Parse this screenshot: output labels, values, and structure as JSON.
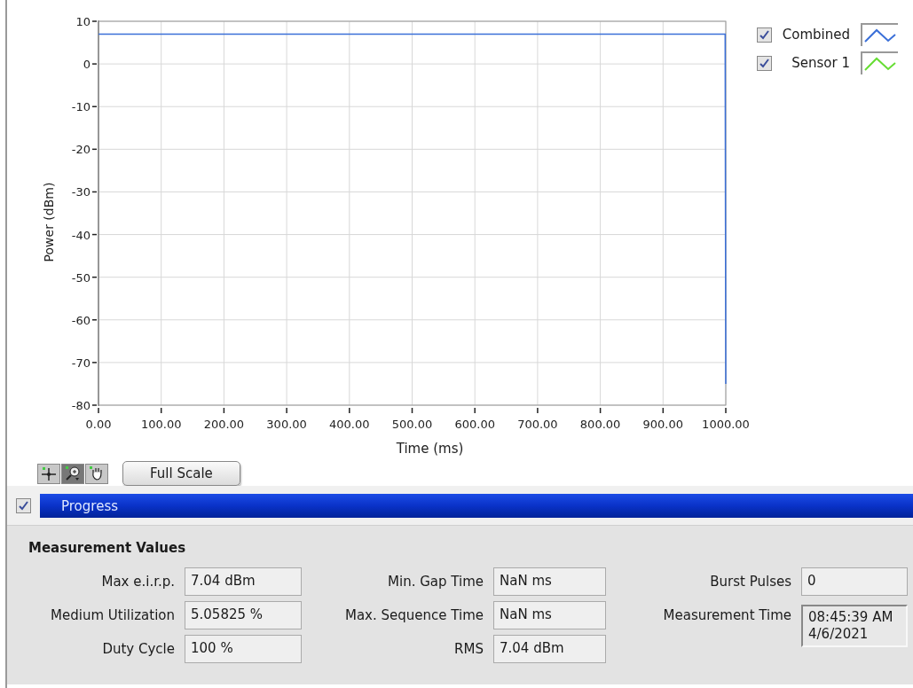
{
  "graph": {
    "chart_data": {
      "type": "line",
      "xlabel": "Time (ms)",
      "ylabel": "Power (dBm)",
      "xlim": [
        0,
        1000
      ],
      "ylim": [
        -80,
        10
      ],
      "grid": true,
      "xticks": [
        {
          "value": 0,
          "label": "0.00"
        },
        {
          "value": 100,
          "label": "100.00"
        },
        {
          "value": 200,
          "label": "200.00"
        },
        {
          "value": 300,
          "label": "300.00"
        },
        {
          "value": 400,
          "label": "400.00"
        },
        {
          "value": 500,
          "label": "500.00"
        },
        {
          "value": 600,
          "label": "600.00"
        },
        {
          "value": 700,
          "label": "700.00"
        },
        {
          "value": 800,
          "label": "800.00"
        },
        {
          "value": 900,
          "label": "900.00"
        },
        {
          "value": 1000,
          "label": "1000.00"
        }
      ],
      "yticks": [
        10,
        0,
        -10,
        -20,
        -30,
        -40,
        -50,
        -60,
        -70,
        -80
      ],
      "x": [
        0,
        999,
        1000
      ],
      "series": [
        {
          "name": "Combined",
          "color": "#3a6fd8",
          "values": [
            7,
            7,
            -75
          ]
        },
        {
          "name": "Sensor 1",
          "color": "#66dd33",
          "values": [
            null,
            null,
            null
          ]
        }
      ]
    },
    "legend": [
      {
        "checked": true
      },
      {
        "checked": true
      }
    ],
    "palette": [
      {
        "kind": "cursor",
        "selected": false
      },
      {
        "kind": "zoom",
        "selected": true
      },
      {
        "kind": "pan",
        "selected": false
      }
    ],
    "full_scale_button": "Full Scale"
  },
  "progress": {
    "checked": true,
    "label": "Progress",
    "level": 1
  },
  "measurements": {
    "title": "Measurement Values",
    "columns": [
      [
        {
          "label": "Max e.i.r.p.",
          "value": "7.04 dBm",
          "kind": "field"
        },
        {
          "label": "Medium Utilization",
          "value": "5.05825 %",
          "kind": "field"
        },
        {
          "label": "Duty Cycle",
          "value": "100 %",
          "kind": "field"
        }
      ],
      [
        {
          "label": "Min. Gap Time",
          "value": "NaN ms",
          "kind": "field"
        },
        {
          "label": "Max. Sequence Time",
          "value": "NaN ms",
          "kind": "field"
        },
        {
          "label": "RMS",
          "value": "7.04 dBm",
          "kind": "field"
        }
      ],
      [
        {
          "label": "Burst Pulses",
          "value": "0",
          "kind": "field"
        },
        {
          "label": "Measurement Time",
          "value": "08:45:39 AM\n4/6/2021",
          "kind": "indicator"
        }
      ]
    ]
  }
}
